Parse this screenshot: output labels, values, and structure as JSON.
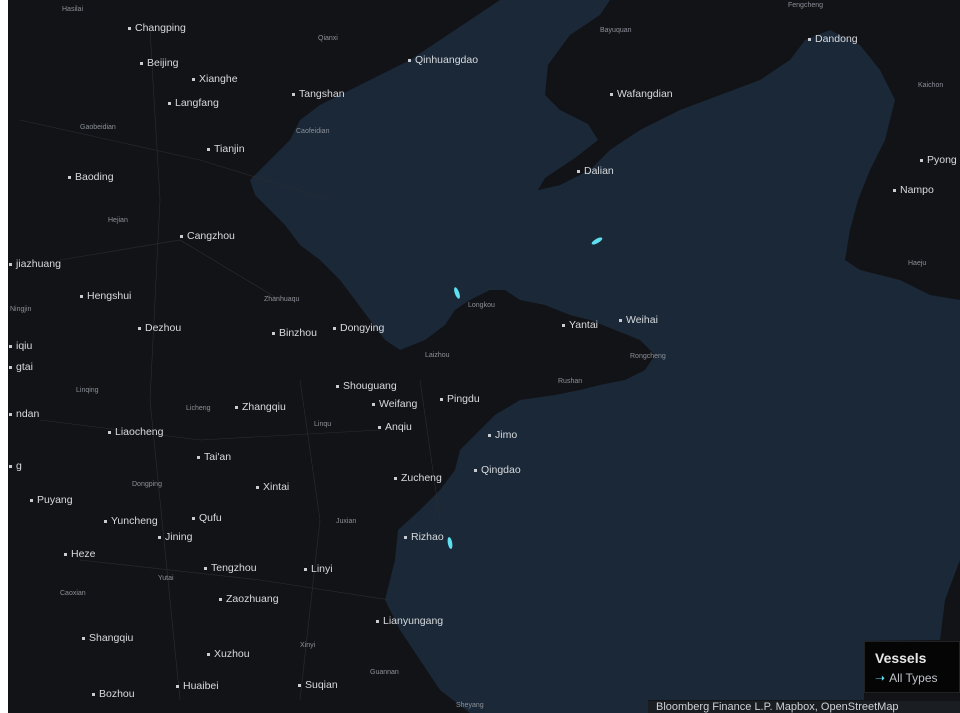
{
  "map": {
    "land_color": "#121316",
    "sea_color": "#1a2838",
    "vessel_color": "#5ee0f0",
    "labels": [
      {
        "id": "hasilai",
        "text": "Hasilai",
        "cls": "minor"
      },
      {
        "id": "changping",
        "text": "Changping",
        "cls": "city"
      },
      {
        "id": "qianxi",
        "text": "Qianxi",
        "cls": "minor"
      },
      {
        "id": "bayuquan",
        "text": "Bayuquan",
        "cls": "minor"
      },
      {
        "id": "fengcheng",
        "text": "Fengcheng",
        "cls": "minor"
      },
      {
        "id": "dandong",
        "text": "Dandong",
        "cls": "city"
      },
      {
        "id": "beijing",
        "text": "Beijing",
        "cls": "city"
      },
      {
        "id": "xianghe",
        "text": "Xianghe",
        "cls": "city"
      },
      {
        "id": "qinhuangdao",
        "text": "Qinhuangdao",
        "cls": "city"
      },
      {
        "id": "tangshan",
        "text": "Tangshan",
        "cls": "city"
      },
      {
        "id": "langfang",
        "text": "Langfang",
        "cls": "city"
      },
      {
        "id": "wafangdian",
        "text": "Wafangdian",
        "cls": "city"
      },
      {
        "id": "kaichon",
        "text": "Kaichon",
        "cls": "minor"
      },
      {
        "id": "gaobeidian",
        "text": "Gaobeidian",
        "cls": "minor"
      },
      {
        "id": "caofeidian",
        "text": "Caofeidian",
        "cls": "minor"
      },
      {
        "id": "tianjin",
        "text": "Tianjin",
        "cls": "city"
      },
      {
        "id": "pyong",
        "text": "Pyong",
        "cls": "city"
      },
      {
        "id": "baoding",
        "text": "Baoding",
        "cls": "city"
      },
      {
        "id": "dalian",
        "text": "Dalian",
        "cls": "city"
      },
      {
        "id": "nampo",
        "text": "Nampo",
        "cls": "city"
      },
      {
        "id": "hejian",
        "text": "Hejian",
        "cls": "minor"
      },
      {
        "id": "cangzhou",
        "text": "Cangzhou",
        "cls": "city"
      },
      {
        "id": "haeju",
        "text": "Haeju",
        "cls": "minor"
      },
      {
        "id": "jiazhuang",
        "text": "jiazhuang",
        "cls": "city"
      },
      {
        "id": "hengshui",
        "text": "Hengshui",
        "cls": "city"
      },
      {
        "id": "zhanhuaqu",
        "text": "Zhanhuaqu",
        "cls": "minor"
      },
      {
        "id": "longkou",
        "text": "Longkou",
        "cls": "minor"
      },
      {
        "id": "ningjin",
        "text": "Ningjin",
        "cls": "minor"
      },
      {
        "id": "dezhou",
        "text": "Dezhou",
        "cls": "city"
      },
      {
        "id": "binzhou",
        "text": "Binzhou",
        "cls": "city"
      },
      {
        "id": "dongying",
        "text": "Dongying",
        "cls": "city"
      },
      {
        "id": "yantai",
        "text": "Yantai",
        "cls": "city"
      },
      {
        "id": "weihai",
        "text": "Weihai",
        "cls": "city"
      },
      {
        "id": "iqiu",
        "text": "iqiu",
        "cls": "city"
      },
      {
        "id": "laizhou",
        "text": "Laizhou",
        "cls": "minor"
      },
      {
        "id": "rongcheng",
        "text": "Rongcheng",
        "cls": "minor"
      },
      {
        "id": "gtai",
        "text": "gtai",
        "cls": "city"
      },
      {
        "id": "linqing",
        "text": "Linqing",
        "cls": "minor"
      },
      {
        "id": "shouguang",
        "text": "Shouguang",
        "cls": "city"
      },
      {
        "id": "rushan",
        "text": "Rushan",
        "cls": "minor"
      },
      {
        "id": "pingdu",
        "text": "Pingdu",
        "cls": "city"
      },
      {
        "id": "licheng",
        "text": "Licheng",
        "cls": "minor"
      },
      {
        "id": "zhangqiu",
        "text": "Zhangqiu",
        "cls": "city"
      },
      {
        "id": "weifang",
        "text": "Weifang",
        "cls": "city"
      },
      {
        "id": "ndan",
        "text": "ndan",
        "cls": "city"
      },
      {
        "id": "linqu",
        "text": "Linqu",
        "cls": "minor"
      },
      {
        "id": "anqiu",
        "text": "Anqiu",
        "cls": "city"
      },
      {
        "id": "liaocheng",
        "text": "Liaocheng",
        "cls": "city"
      },
      {
        "id": "jimo",
        "text": "Jimo",
        "cls": "city"
      },
      {
        "id": "taian",
        "text": "Tai'an",
        "cls": "city"
      },
      {
        "id": "g",
        "text": "g",
        "cls": "city"
      },
      {
        "id": "qingdao",
        "text": "Qingdao",
        "cls": "city"
      },
      {
        "id": "zucheng",
        "text": "Zucheng",
        "cls": "city"
      },
      {
        "id": "dongping",
        "text": "Dongping",
        "cls": "minor"
      },
      {
        "id": "xintai",
        "text": "Xintai",
        "cls": "city"
      },
      {
        "id": "puyang",
        "text": "Puyang",
        "cls": "city"
      },
      {
        "id": "yuncheng",
        "text": "Yuncheng",
        "cls": "city"
      },
      {
        "id": "qufu",
        "text": "Qufu",
        "cls": "city"
      },
      {
        "id": "juxian",
        "text": "Juxian",
        "cls": "minor"
      },
      {
        "id": "jining",
        "text": "Jining",
        "cls": "city"
      },
      {
        "id": "rizhao",
        "text": "Rizhao",
        "cls": "city"
      },
      {
        "id": "heze",
        "text": "Heze",
        "cls": "city"
      },
      {
        "id": "tengzhou",
        "text": "Tengzhou",
        "cls": "city"
      },
      {
        "id": "linyi",
        "text": "Linyi",
        "cls": "city"
      },
      {
        "id": "yutai",
        "text": "Yutai",
        "cls": "minor"
      },
      {
        "id": "caoxian",
        "text": "Caoxian",
        "cls": "minor"
      },
      {
        "id": "zaozhuang",
        "text": "Zaozhuang",
        "cls": "city"
      },
      {
        "id": "lianyungang",
        "text": "Lianyungang",
        "cls": "city"
      },
      {
        "id": "shangqiu",
        "text": "Shangqiu",
        "cls": "city"
      },
      {
        "id": "xinyi",
        "text": "Xinyi",
        "cls": "minor"
      },
      {
        "id": "xuzhou",
        "text": "Xuzhou",
        "cls": "city"
      },
      {
        "id": "guannan",
        "text": "Guannan",
        "cls": "minor"
      },
      {
        "id": "huaibei",
        "text": "Huaibei",
        "cls": "city"
      },
      {
        "id": "suqian",
        "text": "Suqian",
        "cls": "city"
      },
      {
        "id": "bozhou",
        "text": "Bozhou",
        "cls": "city"
      },
      {
        "id": "sheyang",
        "text": "Sheyang",
        "cls": "minor"
      }
    ]
  },
  "legend": {
    "title": "Vessels",
    "item": "All Types"
  },
  "attribution": "Bloomberg Finance L.P. Mapbox, OpenStreetMap"
}
